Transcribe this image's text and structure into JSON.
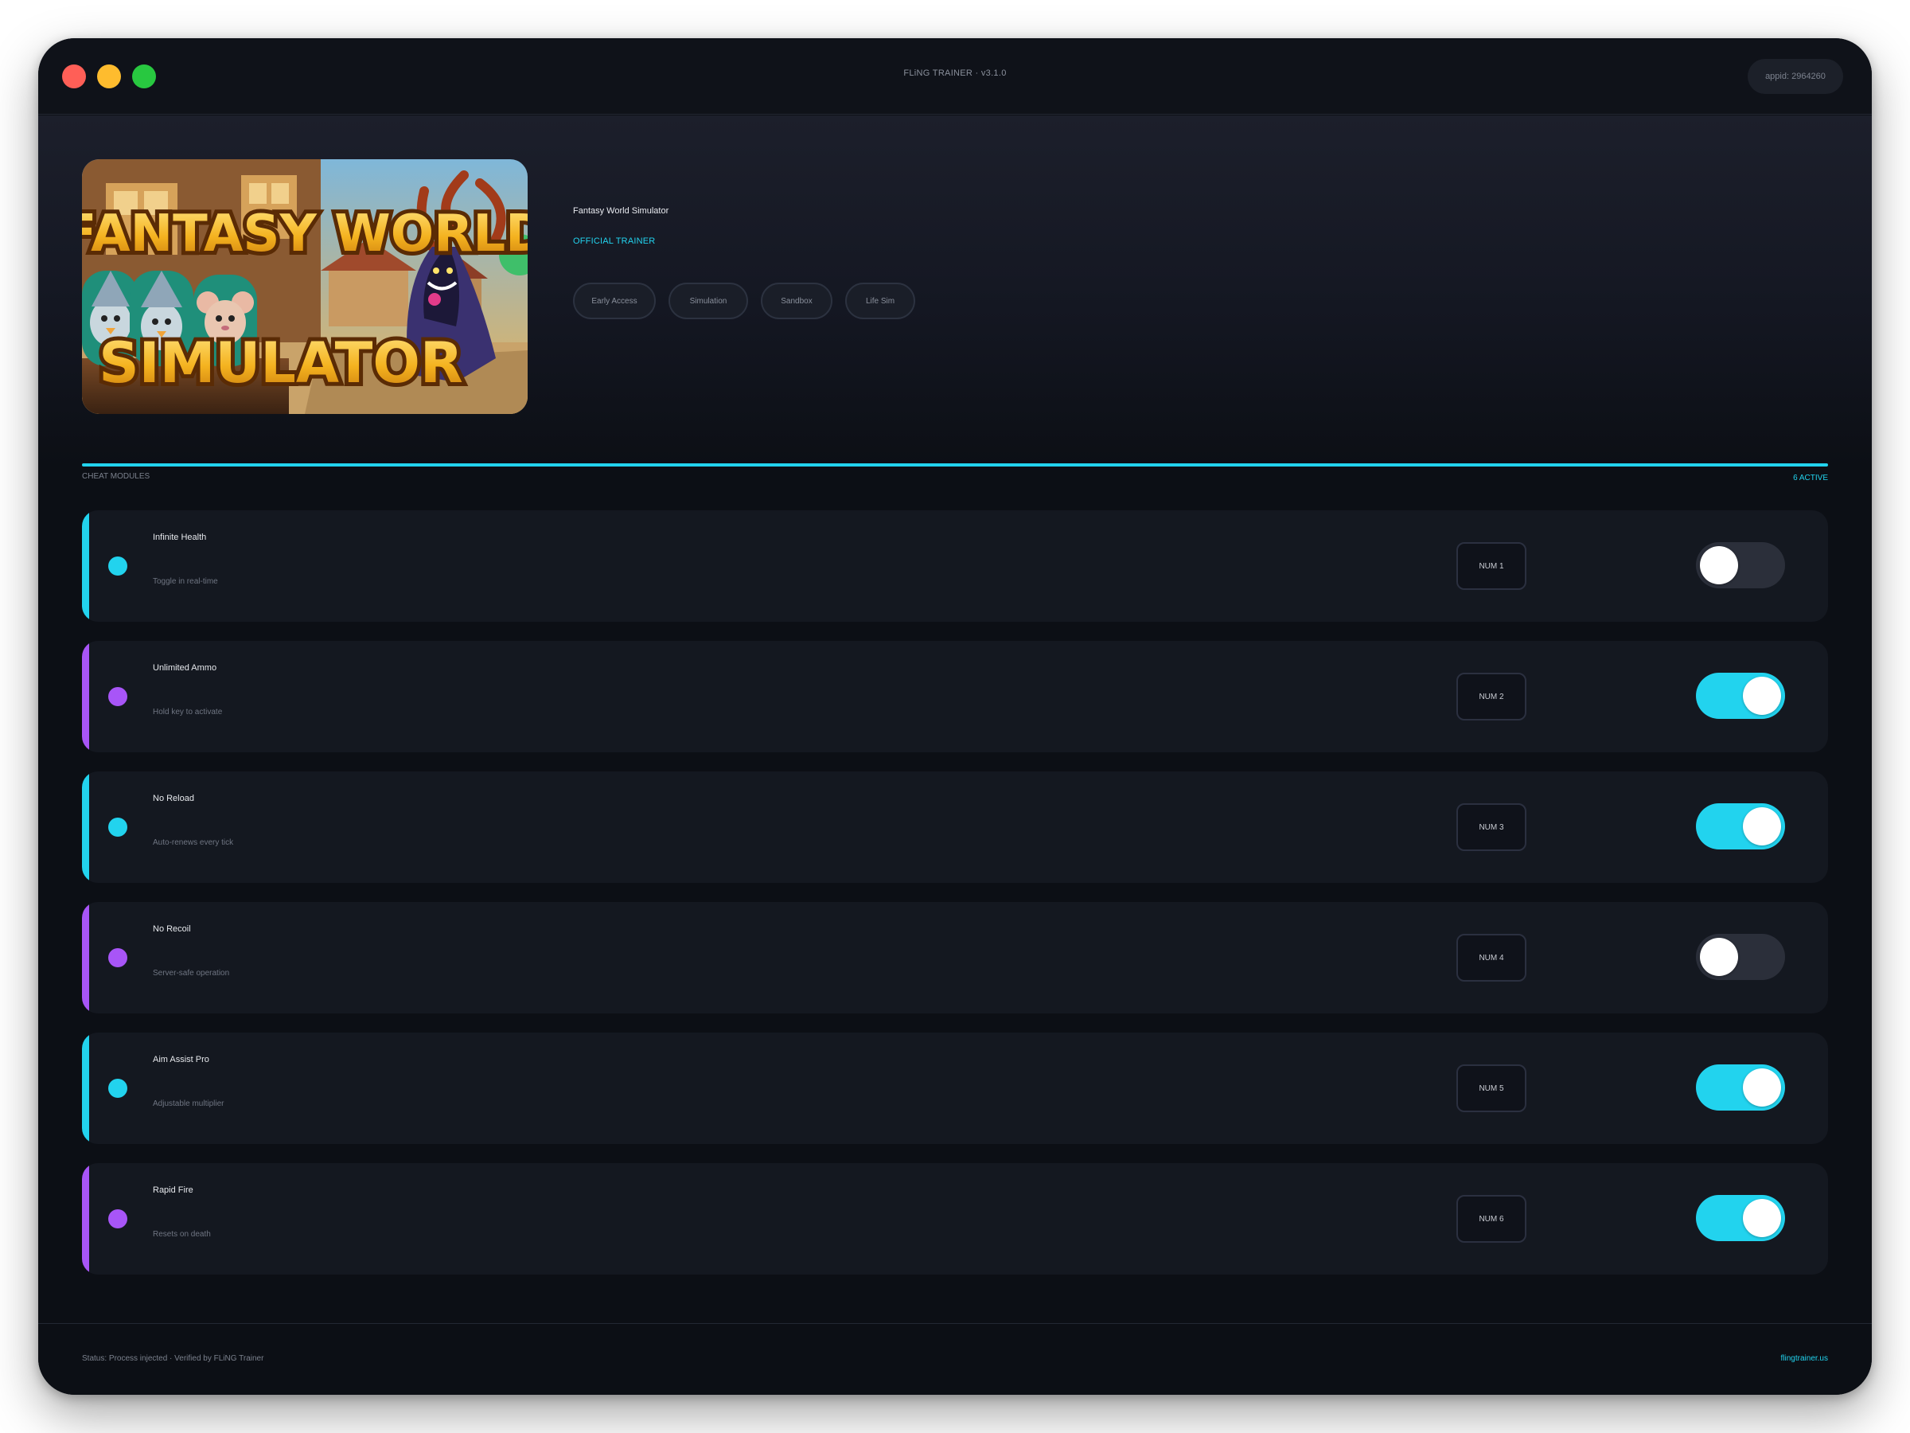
{
  "window": {
    "title": "FLiNG TRAINER · v3.1.0",
    "appid": "appid: 2964260"
  },
  "game": {
    "name": "Fantasy World Simulator",
    "badge": "OFFICIAL TRAINER",
    "cover_text_line1": "FANTASY WORLD",
    "cover_text_line2": "SIMULATOR",
    "tags": [
      "Early Access",
      "Simulation",
      "Sandbox",
      "Life Sim"
    ]
  },
  "section": {
    "label": "CHEAT MODULES",
    "active_count": "6 ACTIVE"
  },
  "modules": [
    {
      "name": "Infinite Health",
      "desc": "Toggle in real-time",
      "hotkey": "NUM 1",
      "enabled": false,
      "accent": "#22d3ee"
    },
    {
      "name": "Unlimited Ammo",
      "desc": "Hold key to activate",
      "hotkey": "NUM 2",
      "enabled": true,
      "accent": "#a855f7"
    },
    {
      "name": "No Reload",
      "desc": "Auto-renews every tick",
      "hotkey": "NUM 3",
      "enabled": true,
      "accent": "#22d3ee"
    },
    {
      "name": "No Recoil",
      "desc": "Server-safe operation",
      "hotkey": "NUM 4",
      "enabled": false,
      "accent": "#a855f7"
    },
    {
      "name": "Aim Assist Pro",
      "desc": "Adjustable multiplier",
      "hotkey": "NUM 5",
      "enabled": true,
      "accent": "#22d3ee"
    },
    {
      "name": "Rapid Fire",
      "desc": "Resets on death",
      "hotkey": "NUM 6",
      "enabled": true,
      "accent": "#a855f7"
    }
  ],
  "footer": {
    "status": "Status: Process injected · Verified by FLiNG Trainer",
    "site": "flingtrainer.us"
  }
}
